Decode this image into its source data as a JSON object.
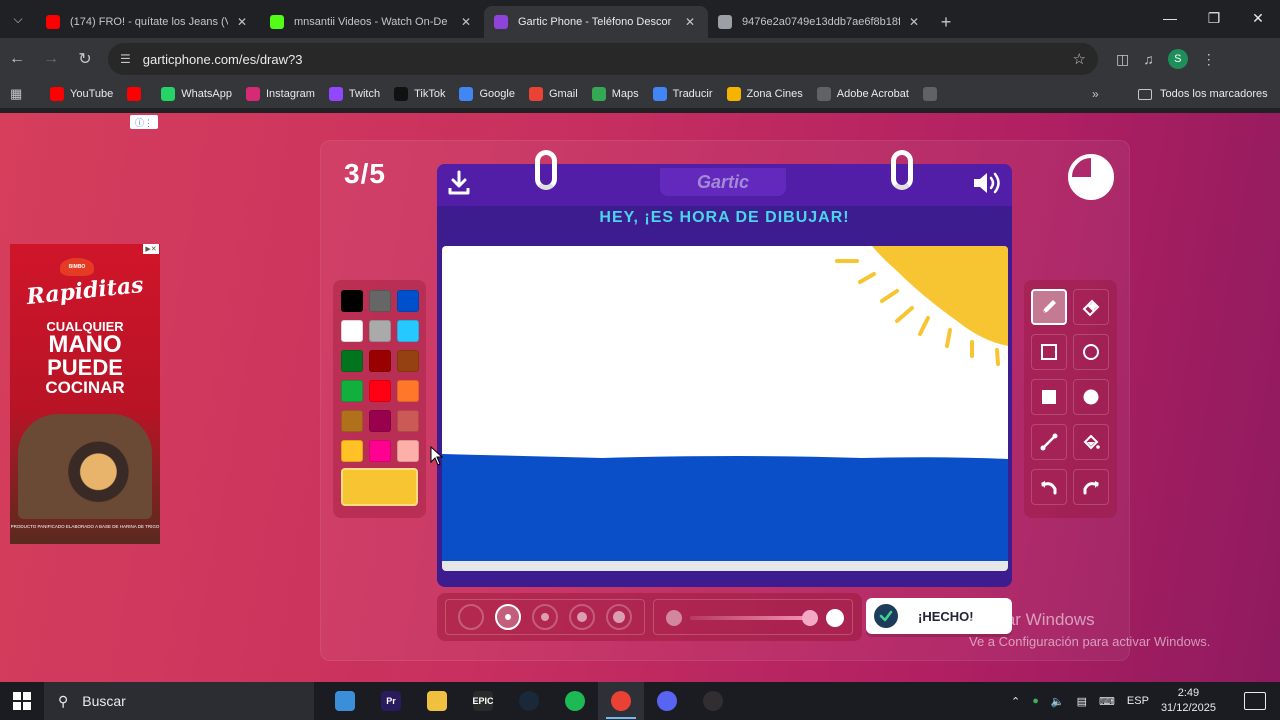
{
  "browser": {
    "tabs": [
      {
        "title": "(174) FRO! - quítate los Jeans (V",
        "favicon": "youtube-icon",
        "color": "#ff0000",
        "active": false
      },
      {
        "title": "mnsantii Videos - Watch On-De",
        "favicon": "kick-icon",
        "color": "#53fc18",
        "active": false
      },
      {
        "title": "Gartic Phone - Teléfono Descor",
        "favicon": "gartic-icon",
        "color": "#8e44d8",
        "active": true
      },
      {
        "title": "9476e2a0749e13ddb7ae6f8b18f",
        "favicon": "globe-icon",
        "color": "#9aa0a6",
        "active": false
      }
    ],
    "url": "garticphone.com/es/draw?3",
    "profile_initial": "S",
    "bookmarks": [
      {
        "label": "YouTube",
        "icon": "youtube-icon",
        "color": "#ff0000"
      },
      {
        "label": "",
        "icon": "youtube-icon",
        "color": "#ff0000"
      },
      {
        "label": "WhatsApp",
        "icon": "whatsapp-icon",
        "color": "#25d366"
      },
      {
        "label": "Instagram",
        "icon": "instagram-icon",
        "color": "#d62976"
      },
      {
        "label": "Twitch",
        "icon": "twitch-icon",
        "color": "#9146ff"
      },
      {
        "label": "TikTok",
        "icon": "tiktok-icon",
        "color": "#111111"
      },
      {
        "label": "Google",
        "icon": "google-icon",
        "color": "#4285f4"
      },
      {
        "label": "Gmail",
        "icon": "gmail-icon",
        "color": "#ea4335"
      },
      {
        "label": "Maps",
        "icon": "maps-icon",
        "color": "#34a853"
      },
      {
        "label": "Traducir",
        "icon": "translate-icon",
        "color": "#4285f4"
      },
      {
        "label": "Zona Cines",
        "icon": "cinema-icon",
        "color": "#f4b400"
      },
      {
        "label": "Adobe Acrobat",
        "icon": "globe-icon",
        "color": "#5f6368"
      },
      {
        "label": "",
        "icon": "globe-icon",
        "color": "#5f6368"
      }
    ],
    "bookmarks_folder": "Todos los marcadores"
  },
  "ad": {
    "brand": "Rapiditas",
    "slogan": [
      "CUALQUIER",
      "MANO",
      "PUEDE",
      "COCINAR"
    ],
    "fine_print": "PRODUCTO PANIFICADO ELABORADO A BASE DE HARINA DE TRIGO"
  },
  "game": {
    "round": "3/5",
    "logo": "Gartic",
    "instruction": "HEY, ¡ES HORA DE DIBUJAR!",
    "done_label": "¡HECHO!",
    "selected_color": "#f7c531",
    "palette": [
      "#000000",
      "#666666",
      "#0050cd",
      "#ffffff",
      "#aaaaaa",
      "#26c9ff",
      "#017420",
      "#990000",
      "#964112",
      "#11b03c",
      "#ff0013",
      "#ff7829",
      "#b0701c",
      "#99004e",
      "#cb5a57",
      "#ffc126",
      "#ff008f",
      "#feafa8"
    ],
    "tools": [
      "pencil-icon",
      "eraser-icon",
      "square-outline-icon",
      "circle-outline-icon",
      "square-filled-icon",
      "circle-filled-icon",
      "line-icon",
      "fill-bucket-icon",
      "undo-icon",
      "redo-icon"
    ],
    "active_tool": "pencil-icon",
    "brush_size_selected_index": 1,
    "opacity_level": 0.85
  },
  "watermark": {
    "line1": "Activar Windows",
    "line2": "Ve a Configuración para activar Windows."
  },
  "taskbar": {
    "search_label": "Buscar",
    "apps": [
      {
        "icon": "file-explorer-icon",
        "label": "",
        "color": "#3a8fd8"
      },
      {
        "icon": "premiere-icon",
        "label": "Pr",
        "color": "#2a1a5e"
      },
      {
        "icon": "folder-icon",
        "label": "",
        "color": "#f0c040"
      },
      {
        "icon": "epic-games-icon",
        "label": "EPIC",
        "color": "#2a2a2a"
      },
      {
        "icon": "steam-icon",
        "label": "",
        "color": "#1b2838"
      },
      {
        "icon": "spotify-icon",
        "label": "",
        "color": "#1db954"
      },
      {
        "icon": "chrome-icon",
        "label": "",
        "color": "#e94235"
      },
      {
        "icon": "discord-icon",
        "label": "",
        "color": "#5865f2"
      },
      {
        "icon": "obs-icon",
        "label": "",
        "color": "#302e31"
      }
    ],
    "active_app_index": 6,
    "language": "ESP",
    "time": "2:49",
    "date": "31/12/2025"
  }
}
